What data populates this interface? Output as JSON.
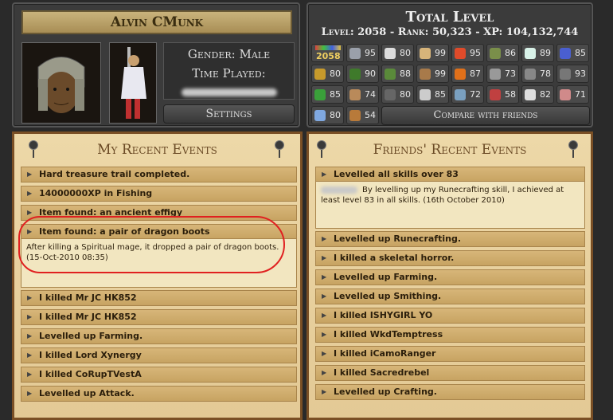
{
  "profile": {
    "name": "Alvin CMunk",
    "gender_label": "Gender: Male",
    "time_played_label": "Time Played:",
    "settings_label": "Settings"
  },
  "stats": {
    "title": "Total Level",
    "summary": "Level: 2058 - Rank: 50,323 - XP: 104,132,744",
    "total": "2058",
    "compare_label": "Compare with friends",
    "skills": [
      {
        "icon": "sword-icon",
        "level": "95",
        "color": "#9aa0aa"
      },
      {
        "icon": "shield-icon",
        "level": "80",
        "color": "#dddddd"
      },
      {
        "icon": "fist-icon",
        "level": "99",
        "color": "#d7b47a"
      },
      {
        "icon": "heart-icon",
        "level": "95",
        "color": "#e04b2a"
      },
      {
        "icon": "bow-icon",
        "level": "86",
        "color": "#7a8f4a"
      },
      {
        "icon": "prayer-icon",
        "level": "89",
        "color": "#d8f2e8"
      },
      {
        "icon": "wizard-hat-icon",
        "level": "85",
        "color": "#4a5fd0"
      },
      {
        "icon": "runecrafting-icon",
        "level": "80",
        "color": "#c79a2b"
      },
      {
        "icon": "tree-icon",
        "level": "90",
        "color": "#3f7a2b"
      },
      {
        "icon": "agility-icon",
        "level": "88",
        "color": "#5a8a3a"
      },
      {
        "icon": "cooking-icon",
        "level": "99",
        "color": "#a87a4a"
      },
      {
        "icon": "fire-icon",
        "level": "87",
        "color": "#e0701a"
      },
      {
        "icon": "smithing-icon",
        "level": "73",
        "color": "#999999"
      },
      {
        "icon": "mining-icon",
        "level": "78",
        "color": "#888888"
      },
      {
        "icon": "pickaxe-icon",
        "level": "93",
        "color": "#777777"
      },
      {
        "icon": "herb-icon",
        "level": "85",
        "color": "#3aa03a"
      },
      {
        "icon": "thieving-icon",
        "level": "74",
        "color": "#b98a5a"
      },
      {
        "icon": "crafting-icon",
        "level": "80",
        "color": "#666666"
      },
      {
        "icon": "fletching-icon",
        "level": "85",
        "color": "#cccccc"
      },
      {
        "icon": "fishing-icon",
        "level": "72",
        "color": "#7aa0c0"
      },
      {
        "icon": "slayer-icon",
        "level": "58",
        "color": "#c04040"
      },
      {
        "icon": "paw-icon",
        "level": "82",
        "color": "#dddddd"
      },
      {
        "icon": "construction-icon",
        "level": "71",
        "color": "#d08a8a"
      },
      {
        "icon": "summoning-icon",
        "level": "80",
        "color": "#7fa8e0"
      },
      {
        "icon": "dungeoneering-icon",
        "level": "54",
        "color": "#b87a3a"
      }
    ]
  },
  "my_events": {
    "title": "My Recent Events",
    "items": [
      "Hard treasure trail completed.",
      "14000000XP in Fishing",
      "Item found: an ancient effigy",
      "Item found: a pair of dragon boots",
      "I killed Mr JC HK852",
      "I killed Mr JC HK852",
      "Levelled up Farming.",
      "I killed Lord Xynergy",
      "I killed CoRupTVestA",
      "Levelled up Attack."
    ],
    "expanded_desc": "After killing a Spiritual mage, it dropped a pair of dragon boots. (15-Oct-2010 08:35)"
  },
  "friend_events": {
    "title": "Friends' Recent Events",
    "items": [
      "Levelled all skills over 83",
      "Levelled up Runecrafting.",
      "I killed a skeletal horror.",
      "Levelled up Farming.",
      "Levelled up Smithing.",
      "I killed ISHYGIRL YO",
      "I killed WkdTemptress",
      "I killed iCamoRanger",
      "I killed Sacredrebel",
      "Levelled up Crafting."
    ],
    "expanded_desc": "By levelling up my Runecrafting skill, I achieved at least level 83 in all skills. (16th October 2010)"
  }
}
